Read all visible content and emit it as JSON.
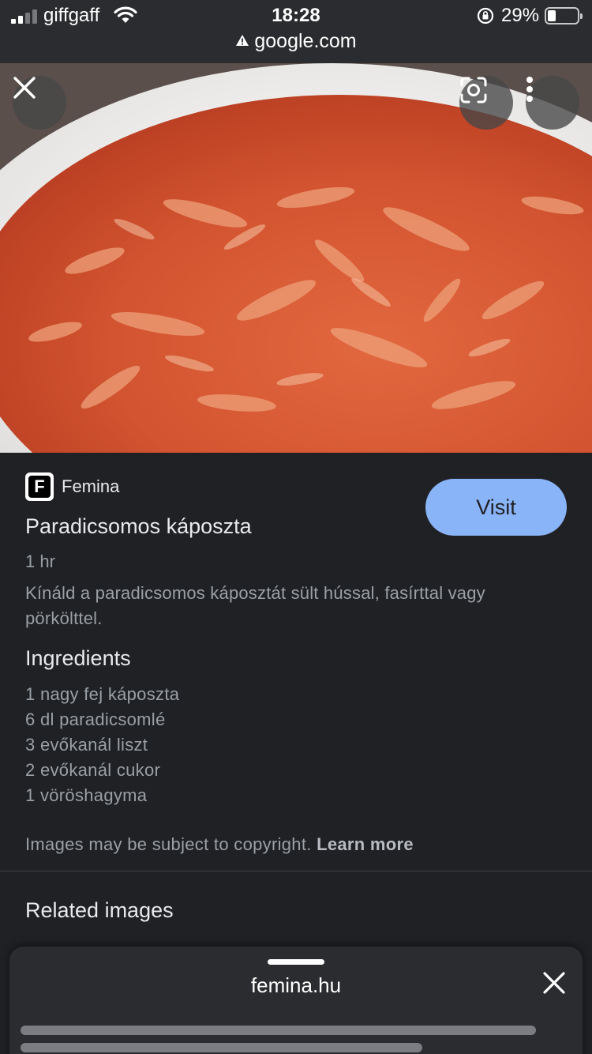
{
  "status_bar": {
    "carrier": "giffgaff",
    "time": "18:28",
    "battery_percent": "29%",
    "battery_level": 0.29,
    "signal_bars_active": 2
  },
  "url_bar": {
    "domain": "google.com",
    "warning_icon": "warning-triangle-icon"
  },
  "image_viewer": {
    "close_icon": "close-icon",
    "lens_icon": "google-lens-icon",
    "more_icon": "more-vertical-icon"
  },
  "result": {
    "source_favicon_letter": "F",
    "source_name": "Femina",
    "visit_label": "Visit",
    "title": "Paradicsomos káposzta",
    "time": "1 hr",
    "description": "Kínáld a paradicsomos káposztát sült hússal, fasírttal vagy pörkölttel.",
    "ingredients_heading": "Ingredients",
    "ingredients": [
      "1 nagy fej káposzta",
      "6 dl paradicsomlé",
      "3 evőkanál liszt",
      "2 evőkanál cukor",
      "1 vöröshagyma"
    ],
    "copyright_text": "Images may be subject to copyright.",
    "learn_more": "Learn more"
  },
  "related": {
    "heading": "Related images"
  },
  "bottom_sheet": {
    "url": "femina.hu"
  },
  "colors": {
    "background": "#202124",
    "accent_button": "#8ab4f8",
    "text_primary": "#e8eaed",
    "text_secondary": "#9aa0a6"
  }
}
